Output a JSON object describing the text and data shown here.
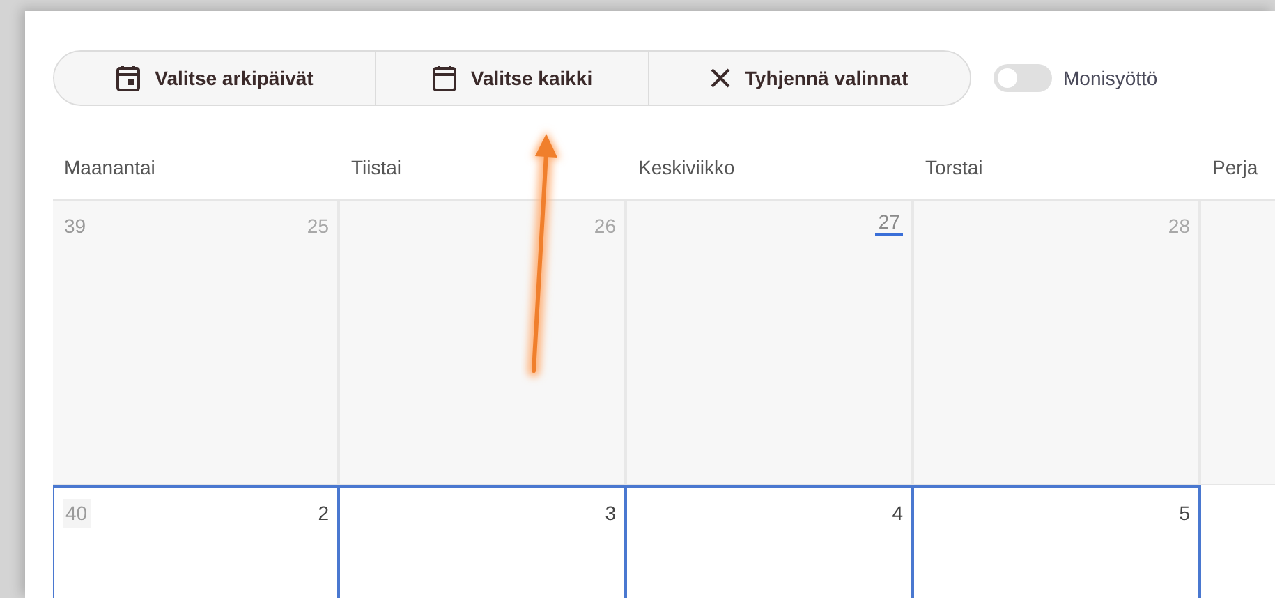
{
  "toolbar": {
    "buttons": [
      {
        "kind": "weekdays",
        "label": "Valitse arkipäivät"
      },
      {
        "kind": "all",
        "label": "Valitse kaikki"
      },
      {
        "kind": "clear",
        "label": "Tyhjennä valinnat"
      }
    ],
    "multi_entry": {
      "label": "Monisyöttö",
      "on": false
    }
  },
  "calendar": {
    "weekdays": [
      "Maanantai",
      "Tiistai",
      "Keskiviikko",
      "Torstai",
      "Perja"
    ],
    "weeks": [
      {
        "week": "39",
        "past": true,
        "days": [
          {
            "day": "25",
            "selected": false,
            "today": false
          },
          {
            "day": "26",
            "selected": false,
            "today": false
          },
          {
            "day": "27",
            "selected": false,
            "today": true
          },
          {
            "day": "28",
            "selected": false,
            "today": false
          }
        ]
      },
      {
        "week": "40",
        "past": false,
        "days": [
          {
            "day": "2",
            "selected": true,
            "today": false
          },
          {
            "day": "3",
            "selected": true,
            "today": false
          },
          {
            "day": "4",
            "selected": true,
            "today": false
          },
          {
            "day": "5",
            "selected": true,
            "today": false
          }
        ]
      }
    ]
  }
}
